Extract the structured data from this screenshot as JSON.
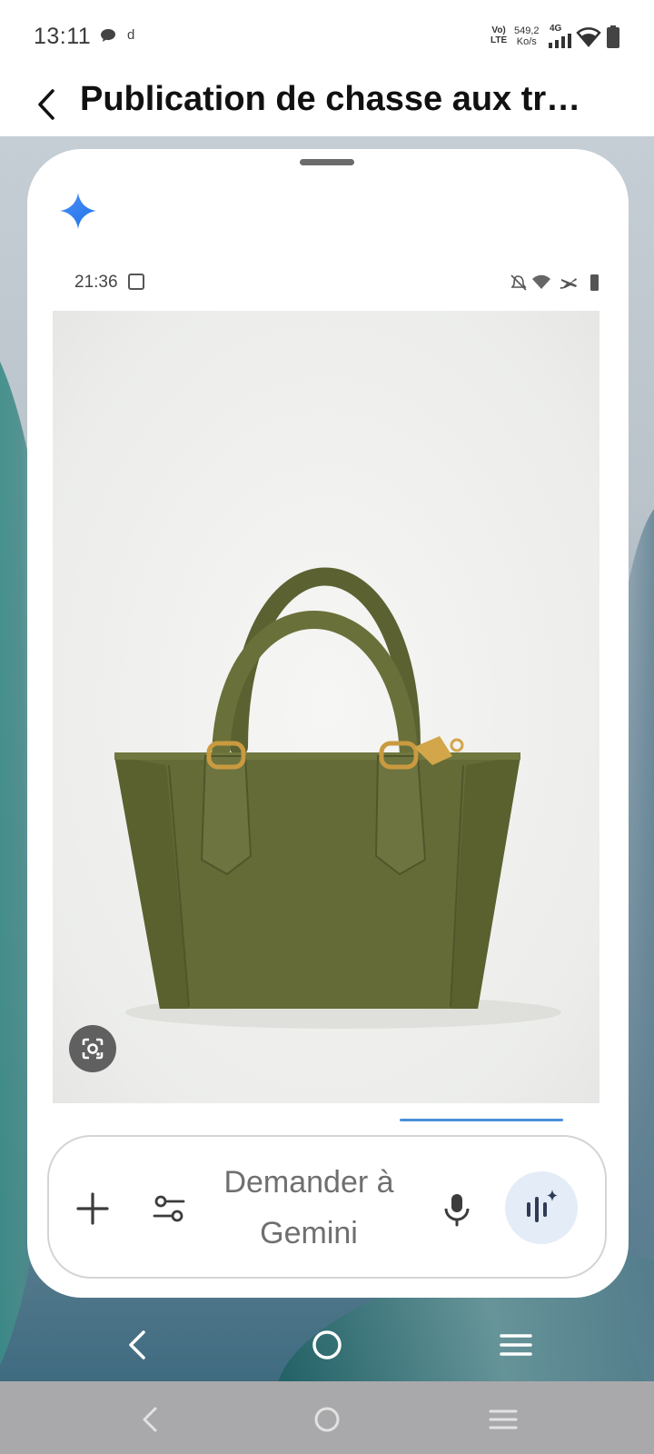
{
  "status_bar": {
    "time": "13:11",
    "d_indicator": "d",
    "volte": "Vo) LTE",
    "speed": "549,2 Ko/s",
    "network": "4G"
  },
  "header": {
    "title": "Publication de chasse aux tr…"
  },
  "gemini_overlay": {
    "screenshot_status": {
      "time": "21:36"
    },
    "photo_subject": "olive green tote handbag",
    "input": {
      "placeholder_line1": "Demander à",
      "placeholder_line2": "Gemini"
    }
  },
  "colors": {
    "gemini_blue": "#1a73e8",
    "bag_green": "#646b36",
    "live_button_bg": "#e4ecf8"
  }
}
